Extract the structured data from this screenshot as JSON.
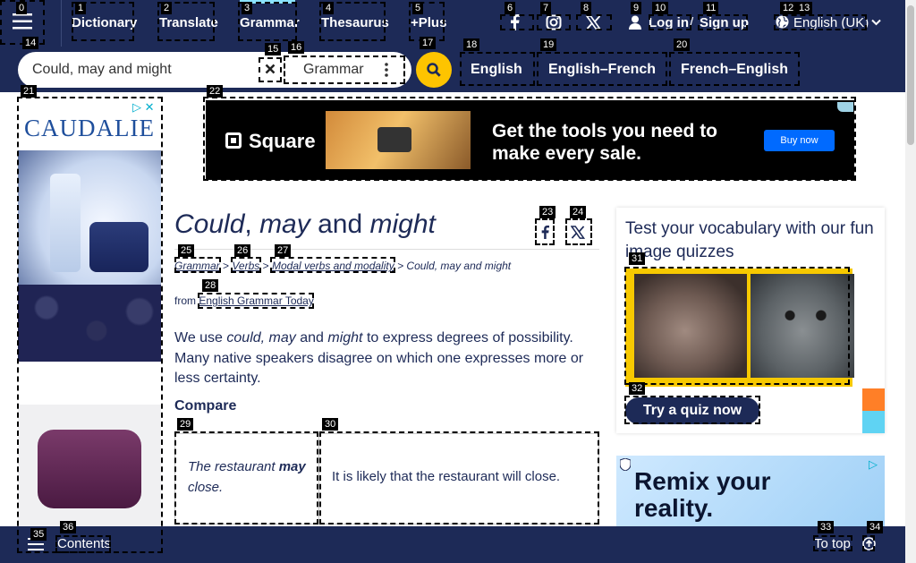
{
  "nav": {
    "items": [
      {
        "label": "Dictionary"
      },
      {
        "label": "Translate"
      },
      {
        "label": "Grammar"
      },
      {
        "label": "Thesaurus"
      },
      {
        "label": "+Plus"
      }
    ],
    "login": "Log in",
    "separator": "/",
    "signup": "Sign up",
    "language": "English (UK)"
  },
  "search": {
    "value": "Could, may and might",
    "dictionary": "Grammar",
    "tabs": [
      "English",
      "English–French",
      "French–English"
    ]
  },
  "ads": {
    "left_brand": "CAUDALIE",
    "top_brand": "Square",
    "top_text": "Get the tools you need to make every sale.",
    "top_cta": "Buy now",
    "right_text": "Remix your reality."
  },
  "article": {
    "title_parts": [
      "Could",
      ", ",
      "may",
      " and ",
      "might"
    ],
    "breadcrumb": [
      "Grammar",
      ">",
      "Verbs",
      ">",
      "Modal verbs and modality",
      "> Could, may and might"
    ],
    "from_label": "from",
    "source": "English Grammar Today",
    "intro_1": "We use ",
    "intro_2": "could, may",
    "intro_3": " and ",
    "intro_4": "might",
    "intro_5": " to express degrees of possibility. Many native speakers disagree on which one expresses more or less certainty.",
    "compare_heading": "Compare",
    "table": {
      "c1_a": "The restaurant ",
      "c1_b": "may",
      "c1_c": " close.",
      "c2": "It is likely that the restaurant will close."
    }
  },
  "quiz": {
    "title": "Test your vocabulary with our fun image quizzes",
    "button": "Try a quiz now"
  },
  "bottom": {
    "contents": "Contents",
    "top": "To top"
  },
  "marker_ids": [
    "0",
    "1",
    "2",
    "3",
    "4",
    "5",
    "6",
    "7",
    "8",
    "9",
    "10",
    "11",
    "12",
    "13",
    "14",
    "15",
    "16",
    "17",
    "18",
    "19",
    "20",
    "21",
    "22",
    "23",
    "24",
    "25",
    "26",
    "27",
    "28",
    "29",
    "30",
    "31",
    "32",
    "33",
    "34",
    "35",
    "36"
  ],
  "colors": {
    "brand_navy": "#1d2a57",
    "search_yellow": "#fec400"
  }
}
